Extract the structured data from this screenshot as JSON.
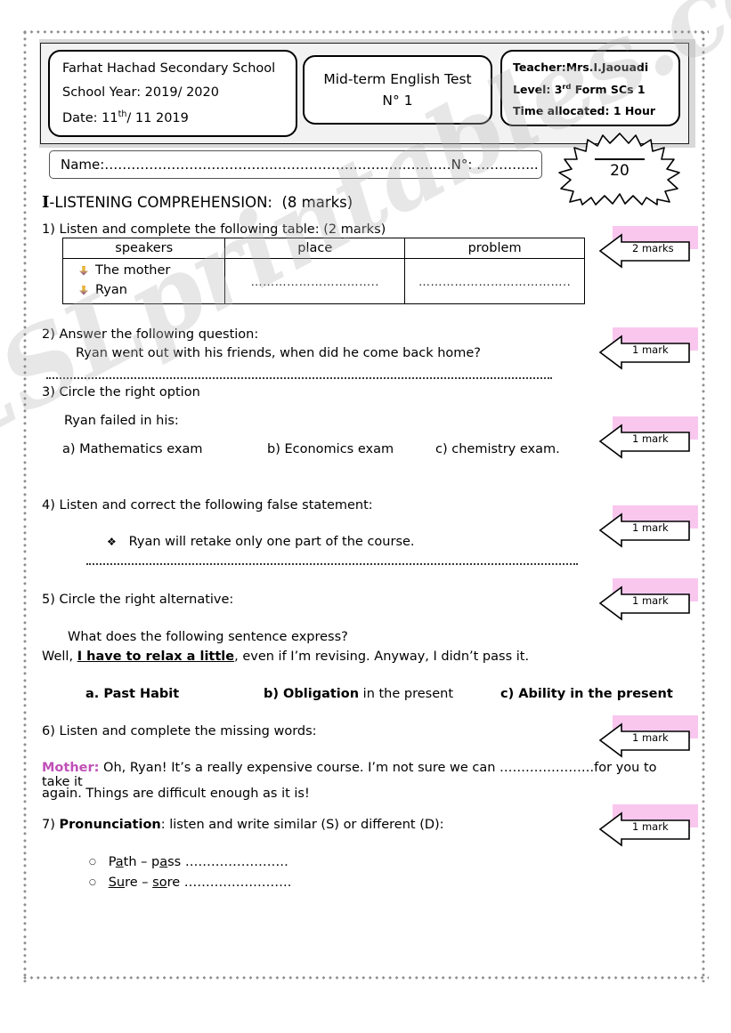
{
  "header": {
    "school_box": {
      "school_name": "Farhat Hachad Secondary School",
      "school_year_label": "School Year: 2019/ 2020",
      "date_label": "Date: 11",
      "date_sup": "th",
      "date_rest": "/ 11 2019"
    },
    "title_box": {
      "title": "Mid-term English Test",
      "number": "N° 1"
    },
    "teacher_box": {
      "teacher": "Teacher:Mrs.I.Jaouadi",
      "level_pre": "Level: 3",
      "level_sup": "rd",
      "level_rest": " Form SCs 1",
      "time": "Time allocated: 1 Hour"
    },
    "name_field": "Name:………………………………..……………….…………………N°: …………..",
    "score_total": "20"
  },
  "section": {
    "roman": "I",
    "title": "-LISTENING COMPREHENSION:",
    "marks": "(8 marks)"
  },
  "questions": {
    "q1": {
      "number": "1)",
      "text": "Listen and complete the following table: (2 marks)",
      "mark": "2 marks",
      "table": {
        "headers": [
          "speakers",
          "place",
          "problem"
        ],
        "speakers": [
          "The mother",
          "Ryan"
        ],
        "place_fill": "…………………………..",
        "problem_fill": "……………………………….."
      }
    },
    "q2": {
      "number": "2)",
      "text": "Answer the following question:",
      "prompt": "Ryan went out with his friends, when did he come back home?",
      "mark": "1 mark"
    },
    "q3": {
      "number": "3)",
      "text": "Circle the right option",
      "stem": "Ryan failed in his:",
      "options": [
        "a)  Mathematics exam",
        "b) Economics exam",
        "c) chemistry exam."
      ],
      "mark": "1 mark"
    },
    "q4": {
      "number": "4)",
      "text": "Listen and correct the following false statement:",
      "statement": "Ryan will retake only one part of the course.",
      "bullet": "❖",
      "mark": "1 mark"
    },
    "q5": {
      "number": "5)",
      "text": "Circle the right alternative:",
      "prompt": "What does the following sentence express?",
      "sentence_pre": "Well, ",
      "sentence_underlined": "I have to relax a little",
      "sentence_post": ", even if I’m revising. Anyway, I didn’t pass it.",
      "options": [
        {
          "label": "a.  Past Habit",
          "bold": "a.  Past Habit",
          "plain": ""
        },
        {
          "label": "b) Obligation in the present",
          "bold": "b) Obligation",
          "plain": " in the present"
        },
        {
          "label": "c) Ability in the present",
          "bold": "c) Ability in the present",
          "plain": ""
        }
      ],
      "mark": "1 mark"
    },
    "q6": {
      "number": "6)",
      "text": "Listen and complete the missing words:",
      "speaker": "Mother:",
      "line1": " Oh, Ryan! It’s a really expensive course. I’m not sure we can ………………….for you to take it",
      "line2": "again. Things are difficult enough as it is!",
      "mark": "1 mark"
    },
    "q7": {
      "number": "7)",
      "text_bold": "Pronunciation",
      "text_rest": ": listen and write similar (S) or different (D):",
      "items": [
        {
          "pre": "P",
          "u1": "a",
          "mid": "th – p",
          "u2": "a",
          "post": "ss ……………………"
        },
        {
          "pre": "",
          "u1": "Su",
          "mid": "re – ",
          "u2": "so",
          "post": "re ……………………."
        }
      ],
      "mark": "1 mark"
    }
  },
  "watermark": "ESLprintables.com"
}
